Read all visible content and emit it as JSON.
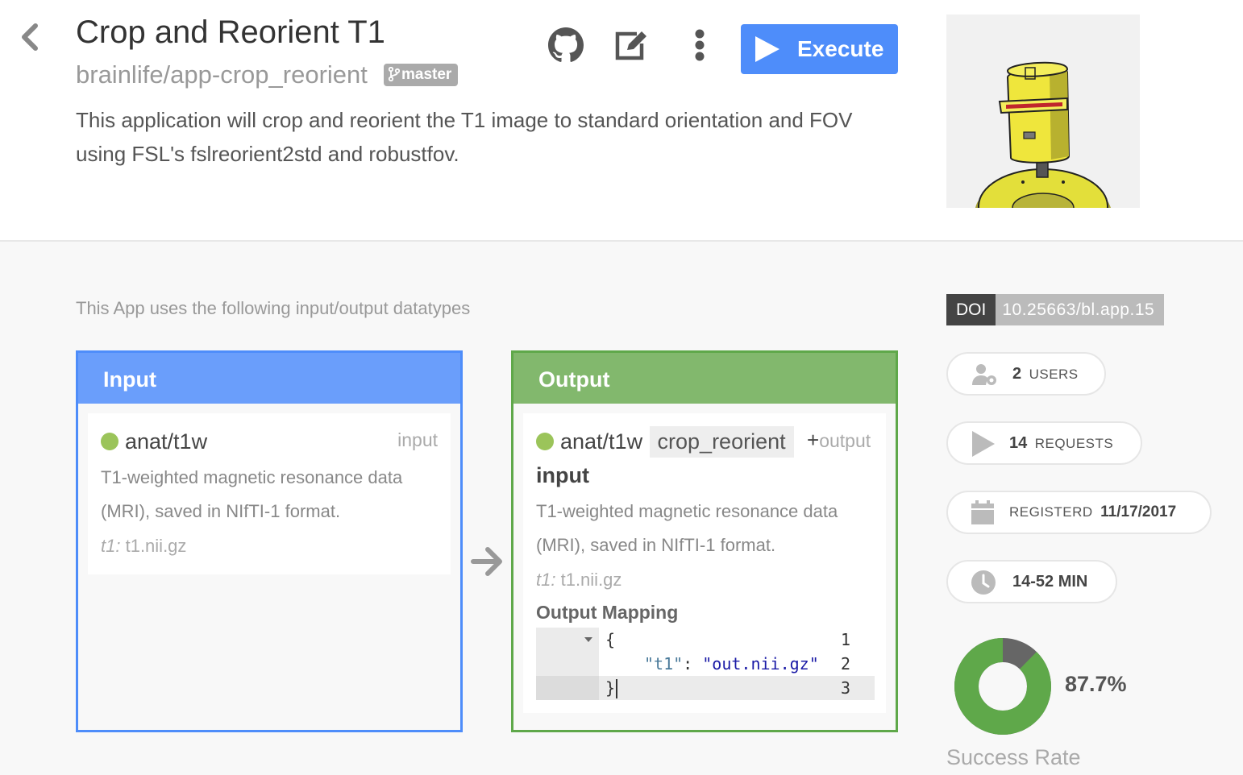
{
  "app": {
    "title": "Crop and Reorient T1",
    "repo": "brainlife/app-crop_reorient",
    "branch": "master",
    "description": "This application will crop and reorient the T1 image to standard orientation and FOV using FSL's fslreorient2std and robustfov.",
    "execute_label": "Execute"
  },
  "icons": {
    "back": "chevron-left-icon",
    "github": "github-icon",
    "edit": "edit-icon",
    "more": "more-vertical-icon",
    "play": "play-icon"
  },
  "datatypes_intro": "This App uses the following input/output datatypes",
  "input": {
    "header": "Input",
    "datatype": "anat/t1w",
    "id": "input",
    "description": "T1-weighted magnetic resonance data (MRI), saved in NIfTI-1 format.",
    "file_key": "t1:",
    "file_name": "t1.nii.gz"
  },
  "output": {
    "header": "Output",
    "datatype": "anat/t1w",
    "tag": "crop_reorient",
    "plus": "+",
    "id_line1": "output",
    "id_line2": "input",
    "description": "T1-weighted magnetic resonance data (MRI), saved in NIfTI-1 format.",
    "file_key": "t1:",
    "file_name": "t1.nii.gz",
    "mapping_title": "Output Mapping",
    "code": {
      "line_numbers": [
        "1",
        "2",
        "3"
      ],
      "line1": "{",
      "line2_key": "\"t1\"",
      "line2_sep": ": ",
      "line2_val": "\"out.nii.gz\"",
      "line3": "}"
    }
  },
  "stats": {
    "doi_label": "DOI",
    "doi_value": "10.25663/bl.app.15",
    "users_count": "2",
    "users_label": "USERS",
    "requests_count": "14",
    "requests_label": "REQUESTS",
    "registered_label": "REGISTERD",
    "registered_date": "11/17/2017",
    "runtime": "14-52 MIN",
    "success_rate": "87.7%",
    "success_rate_value": 0.877,
    "success_label": "Success Rate"
  },
  "colors": {
    "primary": "#4e8dfa",
    "input_header": "#6a9efb",
    "output_border": "#5fa84a",
    "output_header": "#82b86d",
    "datatype_dot": "#9bc45a",
    "success": "#5fa84a",
    "failure": "#666666"
  }
}
